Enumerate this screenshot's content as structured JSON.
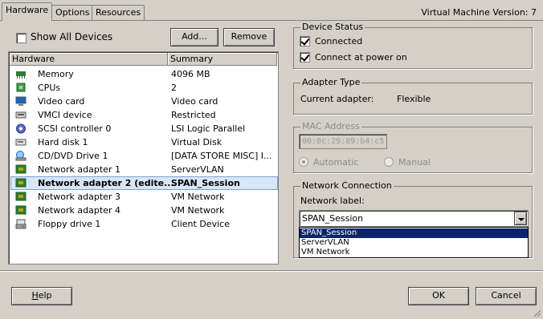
{
  "tabs": [
    {
      "label": "Hardware"
    },
    {
      "label": "Options"
    },
    {
      "label": "Resources"
    }
  ],
  "vm_version": "Virtual Machine Version: 7",
  "show_all_devices": {
    "label": "Show All Devices",
    "checked": false
  },
  "buttons": {
    "add": "Add...",
    "remove": "Remove",
    "help_prefix": "H",
    "help_rest": "elp",
    "ok": "OK",
    "cancel": "Cancel"
  },
  "list": {
    "headers": {
      "hardware": "Hardware",
      "summary": "Summary"
    },
    "rows": [
      {
        "name": "Memory",
        "summary": "4096 MB",
        "icon": "memory-icon",
        "selected": false
      },
      {
        "name": "CPUs",
        "summary": "2",
        "icon": "cpu-icon",
        "selected": false
      },
      {
        "name": "Video card",
        "summary": "Video card",
        "icon": "monitor-icon",
        "selected": false
      },
      {
        "name": "VMCI device",
        "summary": "Restricted",
        "icon": "vmci-device-icon",
        "selected": false
      },
      {
        "name": "SCSI controller 0",
        "summary": "LSI Logic Parallel",
        "icon": "scsi-controller-icon",
        "selected": false
      },
      {
        "name": "Hard disk 1",
        "summary": "Virtual Disk",
        "icon": "hard-disk-icon",
        "selected": false
      },
      {
        "name": "CD/DVD Drive 1",
        "summary": "[DATA STORE MISC] I...",
        "icon": "cd-dvd-icon",
        "selected": false
      },
      {
        "name": "Network adapter 1",
        "summary": "ServerVLAN",
        "icon": "network-adapter-icon",
        "selected": false
      },
      {
        "name": "Network adapter 2 (edite...",
        "summary": "SPAN_Session",
        "icon": "network-adapter-icon",
        "selected": true
      },
      {
        "name": "Network adapter 3",
        "summary": "VM Network",
        "icon": "network-adapter-icon",
        "selected": false
      },
      {
        "name": "Network adapter 4",
        "summary": "VM Network",
        "icon": "network-adapter-icon",
        "selected": false
      },
      {
        "name": "Floppy drive 1",
        "summary": "Client Device",
        "icon": "floppy-icon",
        "selected": false
      }
    ]
  },
  "device_status": {
    "legend": "Device Status",
    "connected": {
      "label": "Connected",
      "checked": true
    },
    "connect_at_power_on": {
      "label": "Connect at power on",
      "checked": true
    }
  },
  "adapter_type": {
    "legend": "Adapter Type",
    "label": "Current adapter:",
    "value": "Flexible"
  },
  "mac_address": {
    "legend": "MAC Address",
    "value": "00:0c:29:89:b4:c5",
    "automatic": "Automatic",
    "manual": "Manual"
  },
  "network_connection": {
    "legend": "Network Connection",
    "label": "Network label:",
    "value": "SPAN_Session",
    "options": [
      "SPAN_Session",
      "ServerVLAN",
      "VM Network"
    ]
  },
  "colors": {
    "selection_highlight": "#0a246a",
    "row_selected_bg": "#d8e6f7",
    "face": "#d4d0c8"
  }
}
